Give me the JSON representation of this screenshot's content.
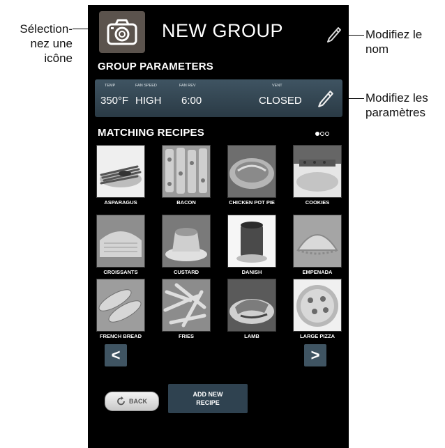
{
  "callouts": {
    "select_icon": "Sélection-\nnez une\nicône",
    "rename": "Modifiez le\nnom",
    "edit_params": "Modifiez les\nparamètres"
  },
  "header": {
    "title": "NEW GROUP"
  },
  "group_parameters": {
    "heading": "GROUP PARAMETERS",
    "params": [
      {
        "label": "TEMP",
        "value": "350°F"
      },
      {
        "label": "FAN SPEED",
        "value": "HIGH"
      },
      {
        "label": "FAN REV",
        "value": "6:00"
      },
      {
        "label": "VENT",
        "value": "CLOSED"
      }
    ]
  },
  "matching_recipes": {
    "heading": "MATCHING RECIPES",
    "page_dots": {
      "total": 3,
      "current": 1
    },
    "recipes": [
      {
        "label": "ASPARAGUS",
        "icon": "asparagus-photo"
      },
      {
        "label": "BACON",
        "icon": "bacon-photo"
      },
      {
        "label": "CHICKEN POT PIE",
        "icon": "chicken-pot-pie-photo"
      },
      {
        "label": "COOKIES",
        "icon": "cookies-photo"
      },
      {
        "label": "CROISSANTS",
        "icon": "croissants-photo"
      },
      {
        "label": "CUSTARD",
        "icon": "custard-photo"
      },
      {
        "label": "DANISH",
        "icon": "danish-photo"
      },
      {
        "label": "EMPENADA",
        "icon": "empenada-photo"
      },
      {
        "label": "FRENCH BREAD",
        "icon": "french-bread-photo"
      },
      {
        "label": "FRIES",
        "icon": "fries-photo"
      },
      {
        "label": "LAMB",
        "icon": "lamb-photo"
      },
      {
        "label": "LARGE PIZZA",
        "icon": "large-pizza-photo"
      }
    ]
  },
  "navigation": {
    "prev": "<",
    "next": ">"
  },
  "footer": {
    "back_label": "BACK",
    "add_label": "ADD NEW RECIPE"
  },
  "colors": {
    "panel": "#3f5462",
    "camera_button": "#5b534d",
    "background": "#000000"
  }
}
